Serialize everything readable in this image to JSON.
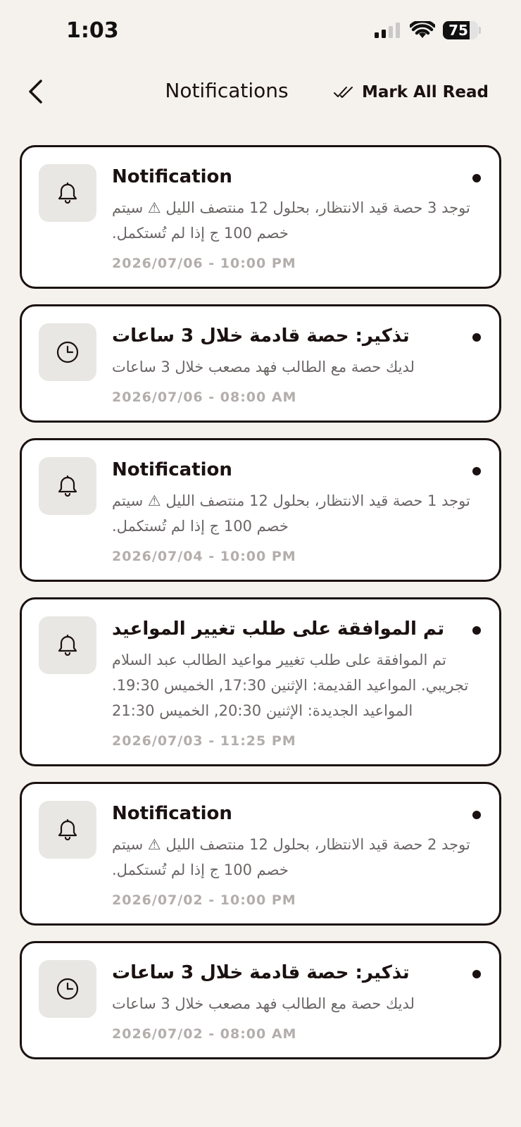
{
  "status_bar": {
    "time": "1:03",
    "battery": "75",
    "battery_level": 0.75
  },
  "header": {
    "title": "Notifications",
    "mark_all_read": "Mark All Read"
  },
  "notifications": [
    {
      "icon": "bell-icon",
      "title": "Notification",
      "body": "توجد 3 حصة قيد الانتظار، بحلول 12 منتصف الليل ⚠ سيتم خصم 100 ج إذا لم تُستكمل.",
      "date": "2026/07/06 - 10:00 PM",
      "unread": true
    },
    {
      "icon": "clock-icon",
      "title": "تذكير: حصة قادمة خلال 3 ساعات",
      "body": "لديك حصة مع الطالب فهد مصعب خلال 3 ساعات",
      "date": "2026/07/06 - 08:00 AM",
      "unread": true
    },
    {
      "icon": "bell-icon",
      "title": "Notification",
      "body": "توجد 1 حصة قيد الانتظار، بحلول 12 منتصف الليل ⚠ سيتم خصم 100 ج إذا لم تُستكمل.",
      "date": "2026/07/04 - 10:00 PM",
      "unread": true
    },
    {
      "icon": "bell-icon",
      "title": "تم الموافقة على طلب تغيير المواعيد",
      "body": "تم الموافقة على طلب تغيير مواعيد الطالب عبد السلام تجريبي. المواعيد القديمة: الإثنين 17:30, الخميس 19:30. المواعيد الجديدة: الإثنين 20:30, الخميس 21:30",
      "date": "2026/07/03 - 11:25 PM",
      "unread": true
    },
    {
      "icon": "bell-icon",
      "title": "Notification",
      "body": "توجد 2 حصة قيد الانتظار، بحلول 12 منتصف الليل ⚠ سيتم خصم 100 ج إذا لم تُستكمل.",
      "date": "2026/07/02 - 10:00 PM",
      "unread": true
    },
    {
      "icon": "clock-icon",
      "title": "تذكير: حصة قادمة خلال 3 ساعات",
      "body": "لديك حصة مع الطالب فهد مصعب خلال 3 ساعات",
      "date": "2026/07/02 - 08:00 AM",
      "unread": true
    }
  ]
}
